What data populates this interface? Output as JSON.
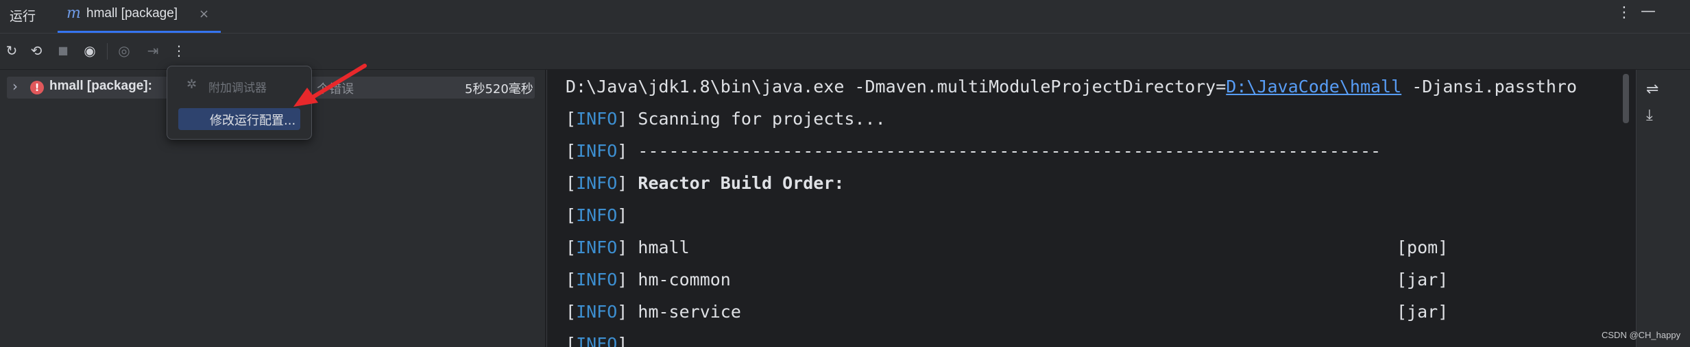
{
  "panel": {
    "title": "运行"
  },
  "tab": {
    "icon": "maven-icon",
    "icon_glyph": "m",
    "label": "hmall [package]",
    "close_glyph": "×"
  },
  "window": {
    "more_glyph": "⋮",
    "minimize_glyph": "—"
  },
  "toolbar": {
    "rerun_glyph": "↻",
    "rerun_failed_glyph": "⟲",
    "stop_glyph": "■",
    "show_glyph": "◉",
    "screenshot_glyph": "◎",
    "export_glyph": "⇥",
    "more_glyph": "⋮"
  },
  "tree": {
    "chevron_glyph": "›",
    "error_glyph": "!",
    "label": "hmall [package]:",
    "error_text": "个错误",
    "duration": "5秒520毫秒"
  },
  "popup": {
    "bug_glyph": "✲",
    "attach_debugger": "附加调试器",
    "edit_config": "修改运行配置..."
  },
  "console": {
    "cmd_prefix": "D:\\Java\\jdk1.8\\bin\\java.exe -Dmaven.multiModuleProjectDirectory=",
    "cmd_link": "D:\\JavaCode\\hmall",
    "cmd_suffix": " -Djansi.passthro",
    "info_open": "[",
    "info_word": "INFO",
    "info_close": "]",
    "line2": " Scanning for projects...",
    "line3": " ------------------------------------------------------------------------",
    "line4": " Reactor Build Order:",
    "modules": [
      {
        "name": " hmall",
        "packaging": "[pom]"
      },
      {
        "name": " hm-common",
        "packaging": "[jar]"
      },
      {
        "name": " hm-service",
        "packaging": "[jar]"
      }
    ]
  },
  "right_strip": {
    "wrap_glyph": "⇌",
    "scroll_end_glyph": "⤓"
  },
  "watermark": "CSDN @CH_happy",
  "colors": {
    "accent": "#3574f0",
    "info": "#3d8fd1",
    "link": "#589df6",
    "error": "#e0585b",
    "arrow": "#e8282b"
  }
}
